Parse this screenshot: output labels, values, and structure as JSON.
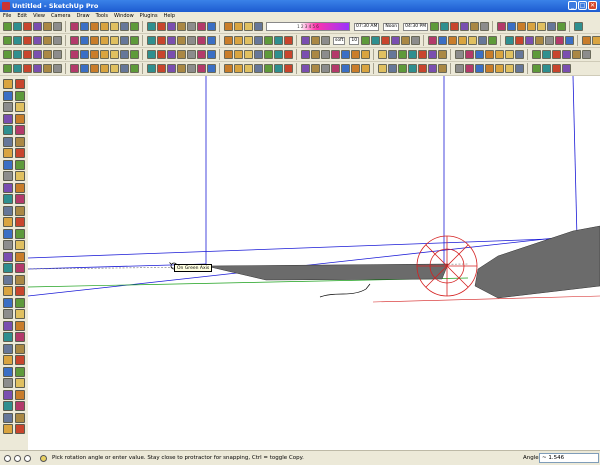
{
  "window": {
    "title": "Untitled - SketchUp Pro",
    "min_label": "_",
    "max_label": "□",
    "close_label": "✕"
  },
  "menu": [
    "File",
    "Edit",
    "View",
    "Camera",
    "Draw",
    "Tools",
    "Window",
    "Plugins",
    "Help"
  ],
  "toolbar1": {
    "color_bar_label": "1 2 3 4 5 6",
    "text1": "07:30 AM",
    "text2": "Noon",
    "text3": "04:30 PM"
  },
  "toolbar2": {
    "soft_label": "soft",
    "smooth_value": "10"
  },
  "tooltip": {
    "text": "On Green Axis"
  },
  "status": {
    "message": "Pick rotation angle or enter value.  Stay close to protractor for snapping, Ctrl = toggle Copy.",
    "vcb_label": "Angle",
    "vcb_value": "~ 1.546"
  },
  "colors": {
    "blue_axis": "#1a1ad6",
    "red_axis": "#d42020",
    "green_axis": "#1ca01c",
    "face": "#6b6b6b"
  },
  "icons": [
    "select-icon",
    "eraser-icon",
    "paint-bucket-icon",
    "line-icon",
    "rectangle-icon",
    "circle-icon",
    "arc-icon",
    "polygon-icon",
    "freehand-icon",
    "push-pull-icon",
    "move-icon",
    "rotate-icon",
    "follow-me-icon",
    "scale-icon",
    "offset-icon",
    "tape-measure-icon",
    "dimension-icon",
    "protractor-icon",
    "text-icon",
    "axes-icon",
    "3d-text-icon",
    "orbit-icon",
    "pan-icon",
    "zoom-icon",
    "zoom-window-icon",
    "zoom-extents-icon",
    "previous-view-icon",
    "next-view-icon",
    "position-camera-icon",
    "walk-icon",
    "look-around-icon",
    "section-plane-icon"
  ]
}
